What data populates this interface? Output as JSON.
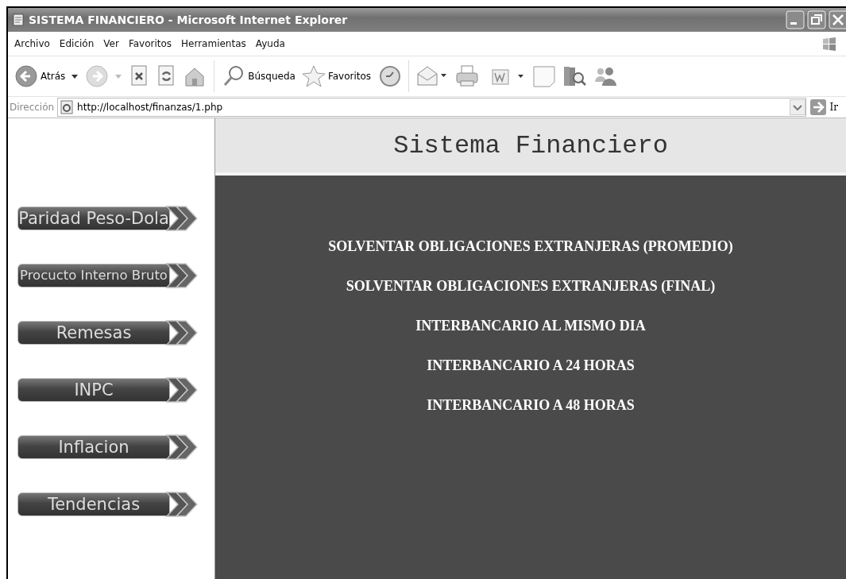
{
  "window": {
    "title": "SISTEMA FINANCIERO - Microsoft Internet Explorer"
  },
  "menu": [
    "Archivo",
    "Edición",
    "Ver",
    "Favoritos",
    "Herramientas",
    "Ayuda"
  ],
  "toolbar": [
    {
      "kind": "back",
      "label": "Atrás"
    },
    {
      "kind": "forward"
    },
    {
      "kind": "stop"
    },
    {
      "kind": "refresh"
    },
    {
      "kind": "home"
    },
    {
      "kind": "search",
      "label": "Búsqueda"
    },
    {
      "kind": "favorites",
      "label": "Favoritos"
    },
    {
      "kind": "history"
    },
    {
      "kind": "mail"
    },
    {
      "kind": "print"
    },
    {
      "kind": "edit"
    },
    {
      "kind": "note"
    },
    {
      "kind": "research"
    },
    {
      "kind": "messenger"
    }
  ],
  "address_bar": {
    "label": "Dirección",
    "url": "http://localhost/finanzas/1.php",
    "go": "Ir"
  },
  "page": {
    "header": "Sistema Financiero",
    "nav_buttons": [
      "Paridad Peso-Dola",
      "Procucto Interno Bruto",
      "Remesas",
      "INPC",
      "Inflacion",
      "Tendencias"
    ],
    "links": [
      "SOLVENTAR OBLIGACIONES EXTRANJERAS (PROMEDIO)",
      "SOLVENTAR OBLIGACIONES EXTRANJERAS (FINAL)",
      "INTERBANCARIO AL MISMO DIA",
      "INTERBANCARIO A 24 HORAS",
      "INTERBANCARIO A 48 HORAS"
    ]
  }
}
